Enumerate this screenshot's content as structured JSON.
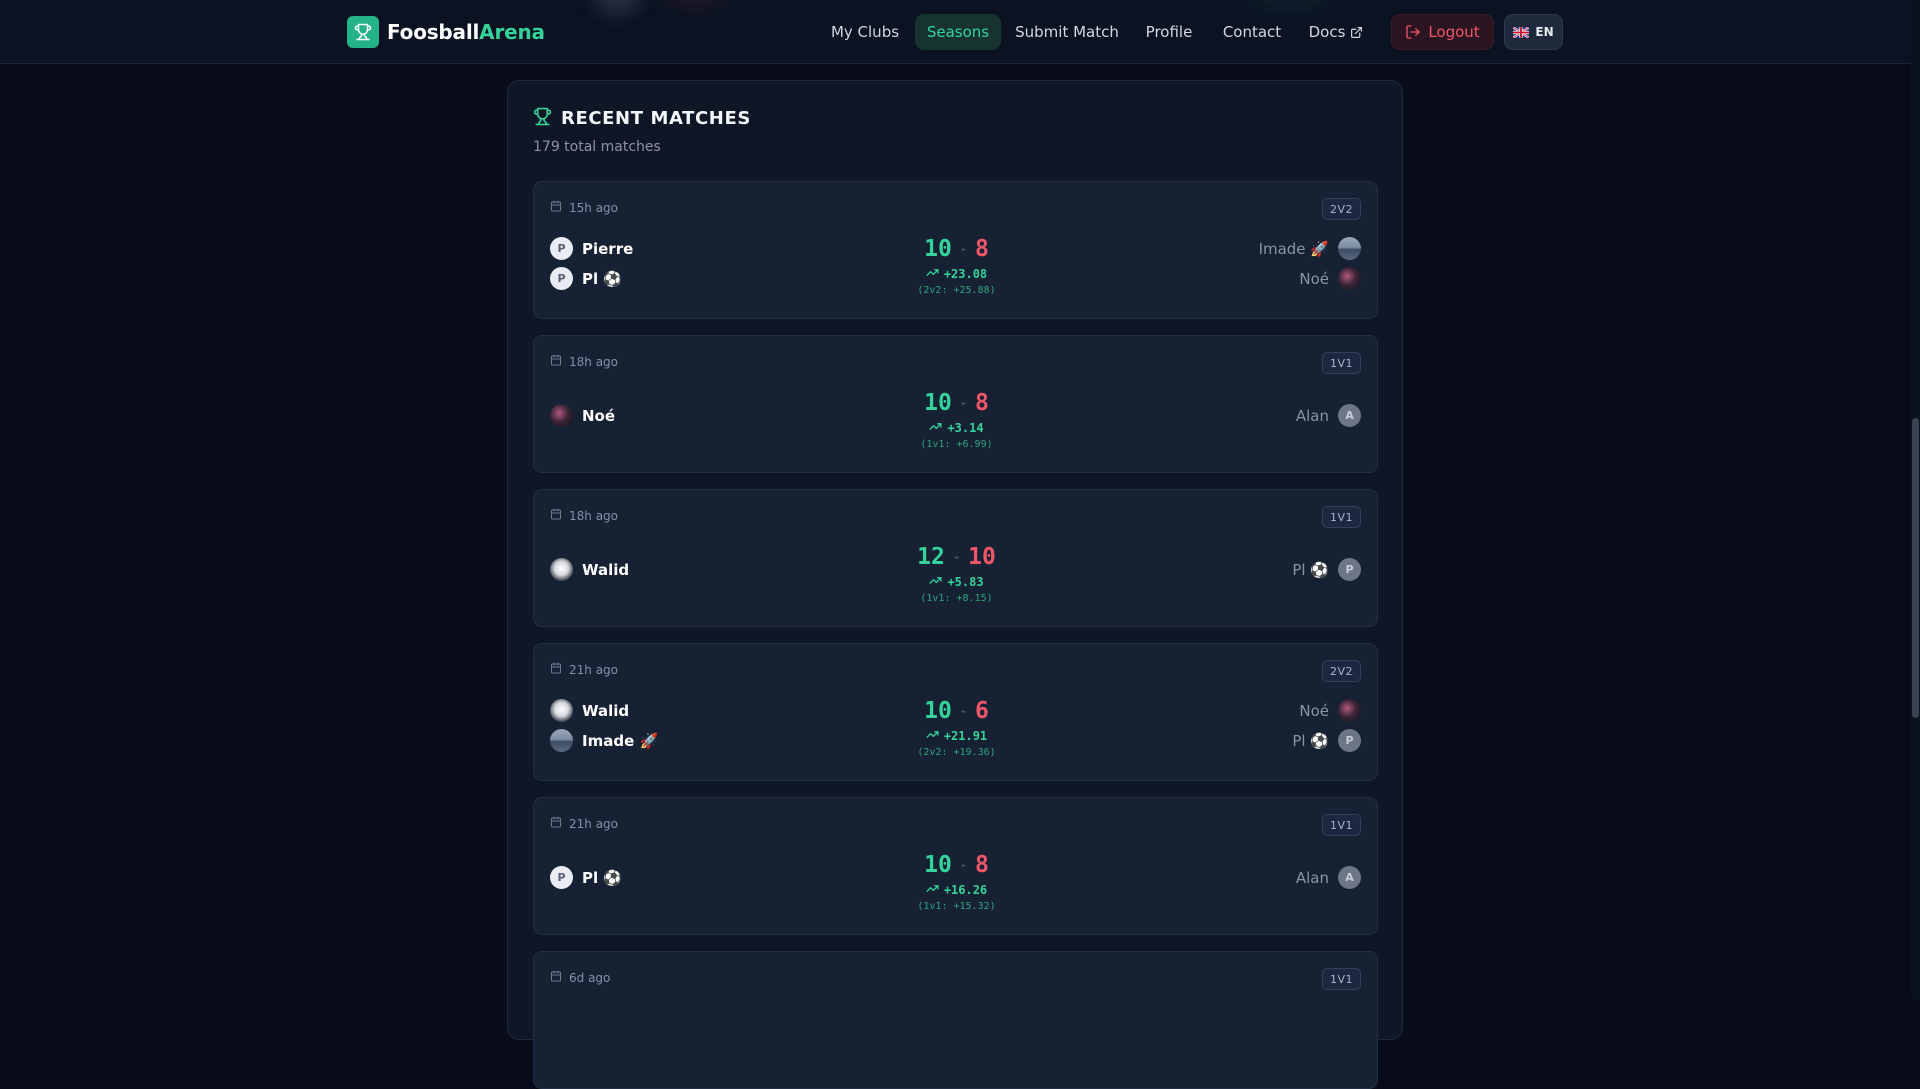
{
  "app": {
    "brand_part1": "Foosball",
    "brand_part2": "Arena",
    "accent_color": "#34d399",
    "danger_color": "#f0566a"
  },
  "nav": {
    "items": [
      {
        "label": "My Clubs",
        "active": false
      },
      {
        "label": "Seasons",
        "active": true
      },
      {
        "label": "Submit Match",
        "active": false
      },
      {
        "label": "Profile",
        "active": false
      },
      {
        "label": "Contact",
        "active": false
      },
      {
        "label": "Docs",
        "active": false,
        "external": true
      }
    ],
    "logout_label": "Logout",
    "language_label": "EN",
    "language_flag": "uk-flag-icon"
  },
  "recent": {
    "title": "RECENT MATCHES",
    "subtitle": "179 total matches",
    "matches": [
      {
        "time": "15h ago",
        "mode": "2V2",
        "winners": [
          {
            "name": "Pierre",
            "avatar": "P",
            "avatar_type": "letter"
          },
          {
            "name": "Pl ⚽",
            "avatar": "P",
            "avatar_type": "letter"
          }
        ],
        "losers": [
          {
            "name": "Imade 🚀",
            "avatar": "",
            "avatar_type": "photo-landscape"
          },
          {
            "name": "Noé",
            "avatar": "",
            "avatar_type": "photo-space"
          }
        ],
        "score_winner": "10",
        "score_loser": "8",
        "separator": "-",
        "delta": "+23.08",
        "delta_detail": "(2v2: +25.88)"
      },
      {
        "time": "18h ago",
        "mode": "1V1",
        "winners": [
          {
            "name": "Noé",
            "avatar": "",
            "avatar_type": "photo-space"
          }
        ],
        "losers": [
          {
            "name": "Alan",
            "avatar": "A",
            "avatar_type": "letter"
          }
        ],
        "score_winner": "10",
        "score_loser": "8",
        "separator": "-",
        "delta": "+3.14",
        "delta_detail": "(1v1: +6.99)"
      },
      {
        "time": "18h ago",
        "mode": "1V1",
        "winners": [
          {
            "name": "Walid",
            "avatar": "",
            "avatar_type": "photo-crest"
          }
        ],
        "losers": [
          {
            "name": "Pl ⚽",
            "avatar": "P",
            "avatar_type": "letter"
          }
        ],
        "score_winner": "12",
        "score_loser": "10",
        "separator": "-",
        "delta": "+5.83",
        "delta_detail": "(1v1: +8.15)"
      },
      {
        "time": "21h ago",
        "mode": "2V2",
        "winners": [
          {
            "name": "Walid",
            "avatar": "",
            "avatar_type": "photo-crest"
          },
          {
            "name": "Imade 🚀",
            "avatar": "",
            "avatar_type": "photo-landscape"
          }
        ],
        "losers": [
          {
            "name": "Noé",
            "avatar": "",
            "avatar_type": "photo-space"
          },
          {
            "name": "Pl ⚽",
            "avatar": "P",
            "avatar_type": "letter"
          }
        ],
        "score_winner": "10",
        "score_loser": "6",
        "separator": "-",
        "delta": "+21.91",
        "delta_detail": "(2v2: +19.36)"
      },
      {
        "time": "21h ago",
        "mode": "1V1",
        "winners": [
          {
            "name": "Pl ⚽",
            "avatar": "P",
            "avatar_type": "letter"
          }
        ],
        "losers": [
          {
            "name": "Alan",
            "avatar": "A",
            "avatar_type": "letter"
          }
        ],
        "score_winner": "10",
        "score_loser": "8",
        "separator": "-",
        "delta": "+16.26",
        "delta_detail": "(1v1: +15.32)"
      },
      {
        "time": "6d ago",
        "mode": "1V1",
        "winners": [],
        "losers": [],
        "score_winner": "",
        "score_loser": "",
        "separator": "",
        "delta": "",
        "delta_detail": ""
      }
    ]
  }
}
